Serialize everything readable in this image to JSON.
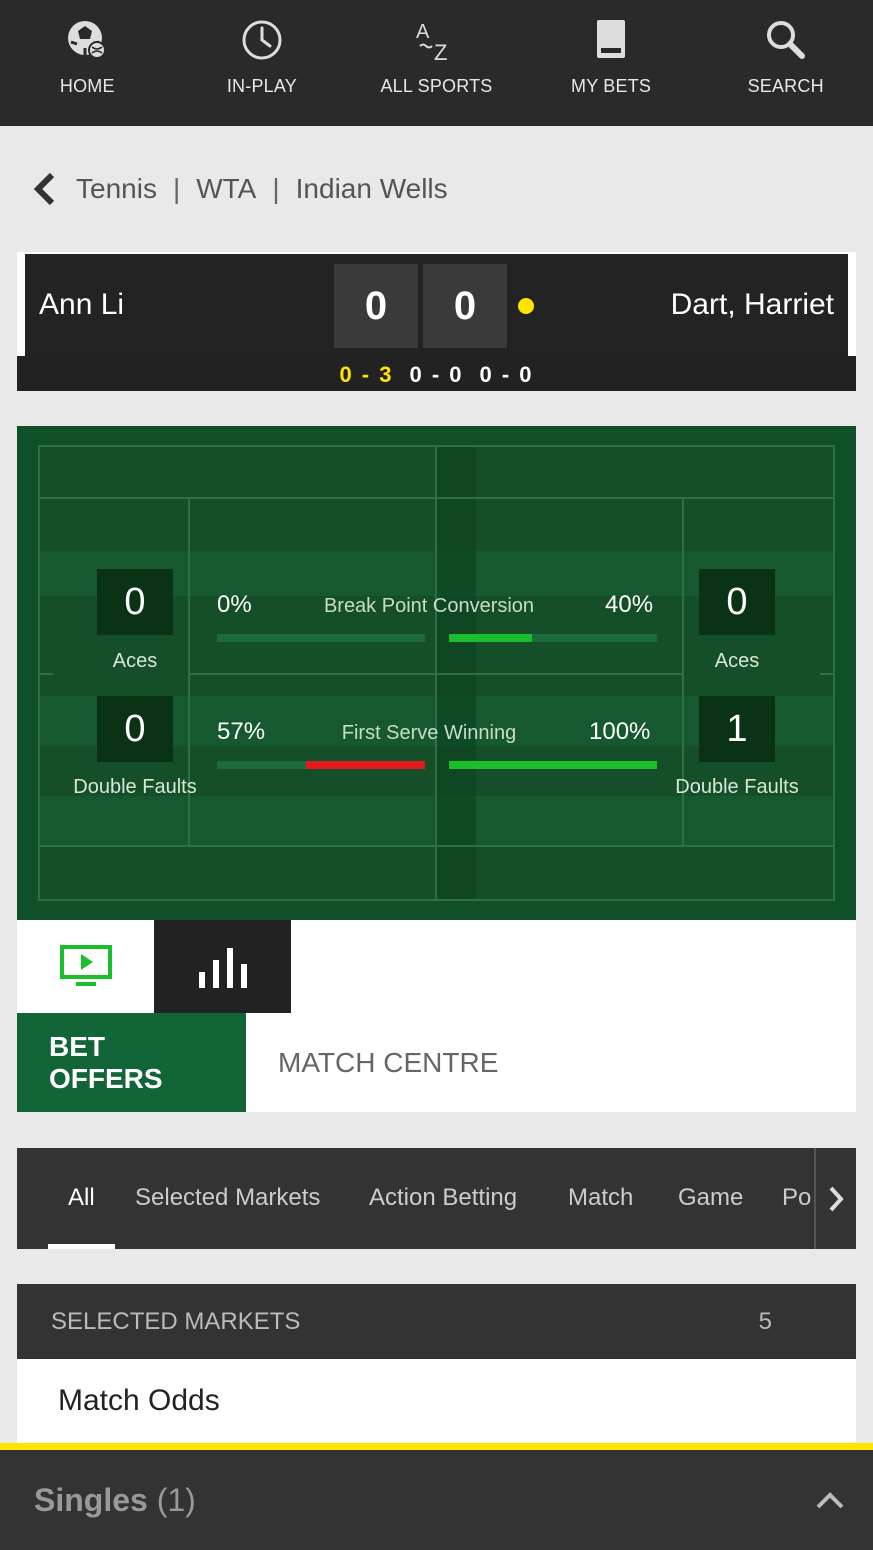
{
  "nav": {
    "items": [
      {
        "label": "HOME",
        "icon": "soccer-ball-icon"
      },
      {
        "label": "IN-PLAY",
        "icon": "clock-icon"
      },
      {
        "label": "ALL SPORTS",
        "icon": "a-z-icon"
      },
      {
        "label": "MY BETS",
        "icon": "betslip-icon"
      },
      {
        "label": "SEARCH",
        "icon": "search-icon"
      }
    ]
  },
  "breadcrumb": {
    "items": [
      "Tennis",
      "WTA",
      "Indian Wells"
    ],
    "separator": "|"
  },
  "scoreboard": {
    "player_left": "Ann Li",
    "player_right": "Dart, Harriet",
    "points_left": "0",
    "points_right": "0",
    "sets": [
      "0 - 3",
      "0 - 0",
      "0 - 0"
    ],
    "serving_color": "#ffe400"
  },
  "stats": {
    "left": {
      "aces": "0",
      "aces_label": "Aces",
      "double_faults": "0",
      "double_faults_label": "Double Faults"
    },
    "right": {
      "aces": "0",
      "aces_label": "Aces",
      "double_faults": "1",
      "double_faults_label": "Double Faults"
    },
    "metrics": [
      {
        "name": "Break Point Conversion",
        "left": "0%",
        "right": "40%",
        "left_value": 0,
        "right_value": 0.4,
        "left_color": "#1bbf2c",
        "right_color": "#1bbf2c"
      },
      {
        "name": "First Serve Winning",
        "left": "57%",
        "right": "100%",
        "left_value": 0.57,
        "right_value": 1.0,
        "left_color": "#e01b1b",
        "right_color": "#1bbf2c"
      }
    ]
  },
  "media_tabs": {
    "video_icon": "tv-play-icon",
    "stats_icon": "bar-chart-icon"
  },
  "main_tabs": {
    "bet_offers": "BET OFFERS",
    "match_centre": "MATCH CENTRE"
  },
  "filter_tabs": [
    "All",
    "Selected Markets",
    "Action Betting",
    "Match",
    "Game",
    "Po"
  ],
  "selected_markets": {
    "title": "SELECTED MARKETS",
    "count": "5",
    "first_market": "Match Odds"
  },
  "bet_slip": {
    "label": "Singles",
    "count": "(1)"
  },
  "colors": {
    "brand_green": "#126536",
    "accent_yellow": "#ffe400",
    "nav_bg": "#2a2a2a"
  }
}
